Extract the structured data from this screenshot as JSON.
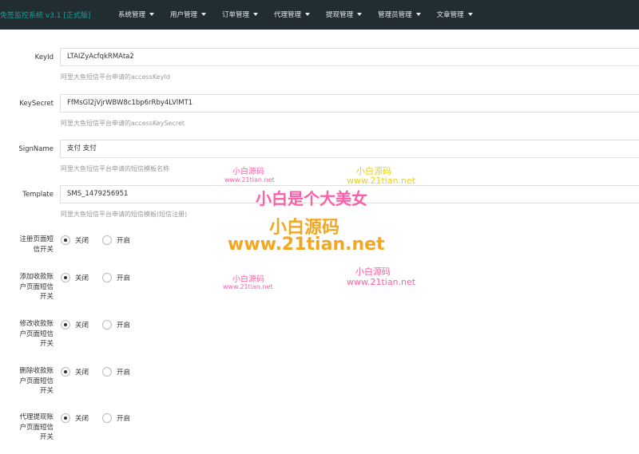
{
  "navbar": {
    "brand": "免签监控系统 v3.1 [正式版]",
    "menu": [
      "系统管理",
      "用户管理",
      "订单管理",
      "代理管理",
      "提现管理",
      "管理员管理",
      "文章管理"
    ]
  },
  "fields": [
    {
      "label": "KeyId",
      "value": "LTAIZyAcfqkRMAta2",
      "hint": "阿里大鱼短信平台申请的accessKeyId"
    },
    {
      "label": "KeySecret",
      "value": "FfMsGl2jVjrWBW8c1bp6rRby4LVlMT1",
      "hint": "阿里大鱼短信平台申请的accessKeySecret"
    },
    {
      "label": "SignName",
      "value": "支付 支付",
      "hint": "阿里大鱼短信平台申请的短信模板名称"
    },
    {
      "label": "Template",
      "value": "SMS_1479256951",
      "hint": "阿里大鱼短信平台申请的短信模板(短信注册)"
    }
  ],
  "switches": [
    {
      "label_lines": [
        "注册页面短",
        "信开关"
      ],
      "off_label": "关闭",
      "on_label": "开启",
      "selected": "关闭"
    },
    {
      "label_lines": [
        "添加收款账",
        "户页面短信",
        "开关"
      ],
      "off_label": "关闭",
      "on_label": "开启",
      "selected": "关闭"
    },
    {
      "label_lines": [
        "修改收款账",
        "户页面短信",
        "开关"
      ],
      "off_label": "关闭",
      "on_label": "开启",
      "selected": "关闭"
    },
    {
      "label_lines": [
        "删除收款账",
        "户页面短信",
        "开关"
      ],
      "off_label": "关闭",
      "on_label": "开启",
      "selected": "关闭"
    },
    {
      "label_lines": [
        "代理提现账",
        "户页面短信",
        "开关"
      ],
      "off_label": "关闭",
      "on_label": "开启",
      "selected": "关闭"
    }
  ],
  "watermarks": {
    "small_logo": "小白源码",
    "small_url": "www.21tian.net",
    "slogan": "小白是个大美女",
    "big_logo": "小白源码",
    "big_url": "www.21tian.net"
  }
}
